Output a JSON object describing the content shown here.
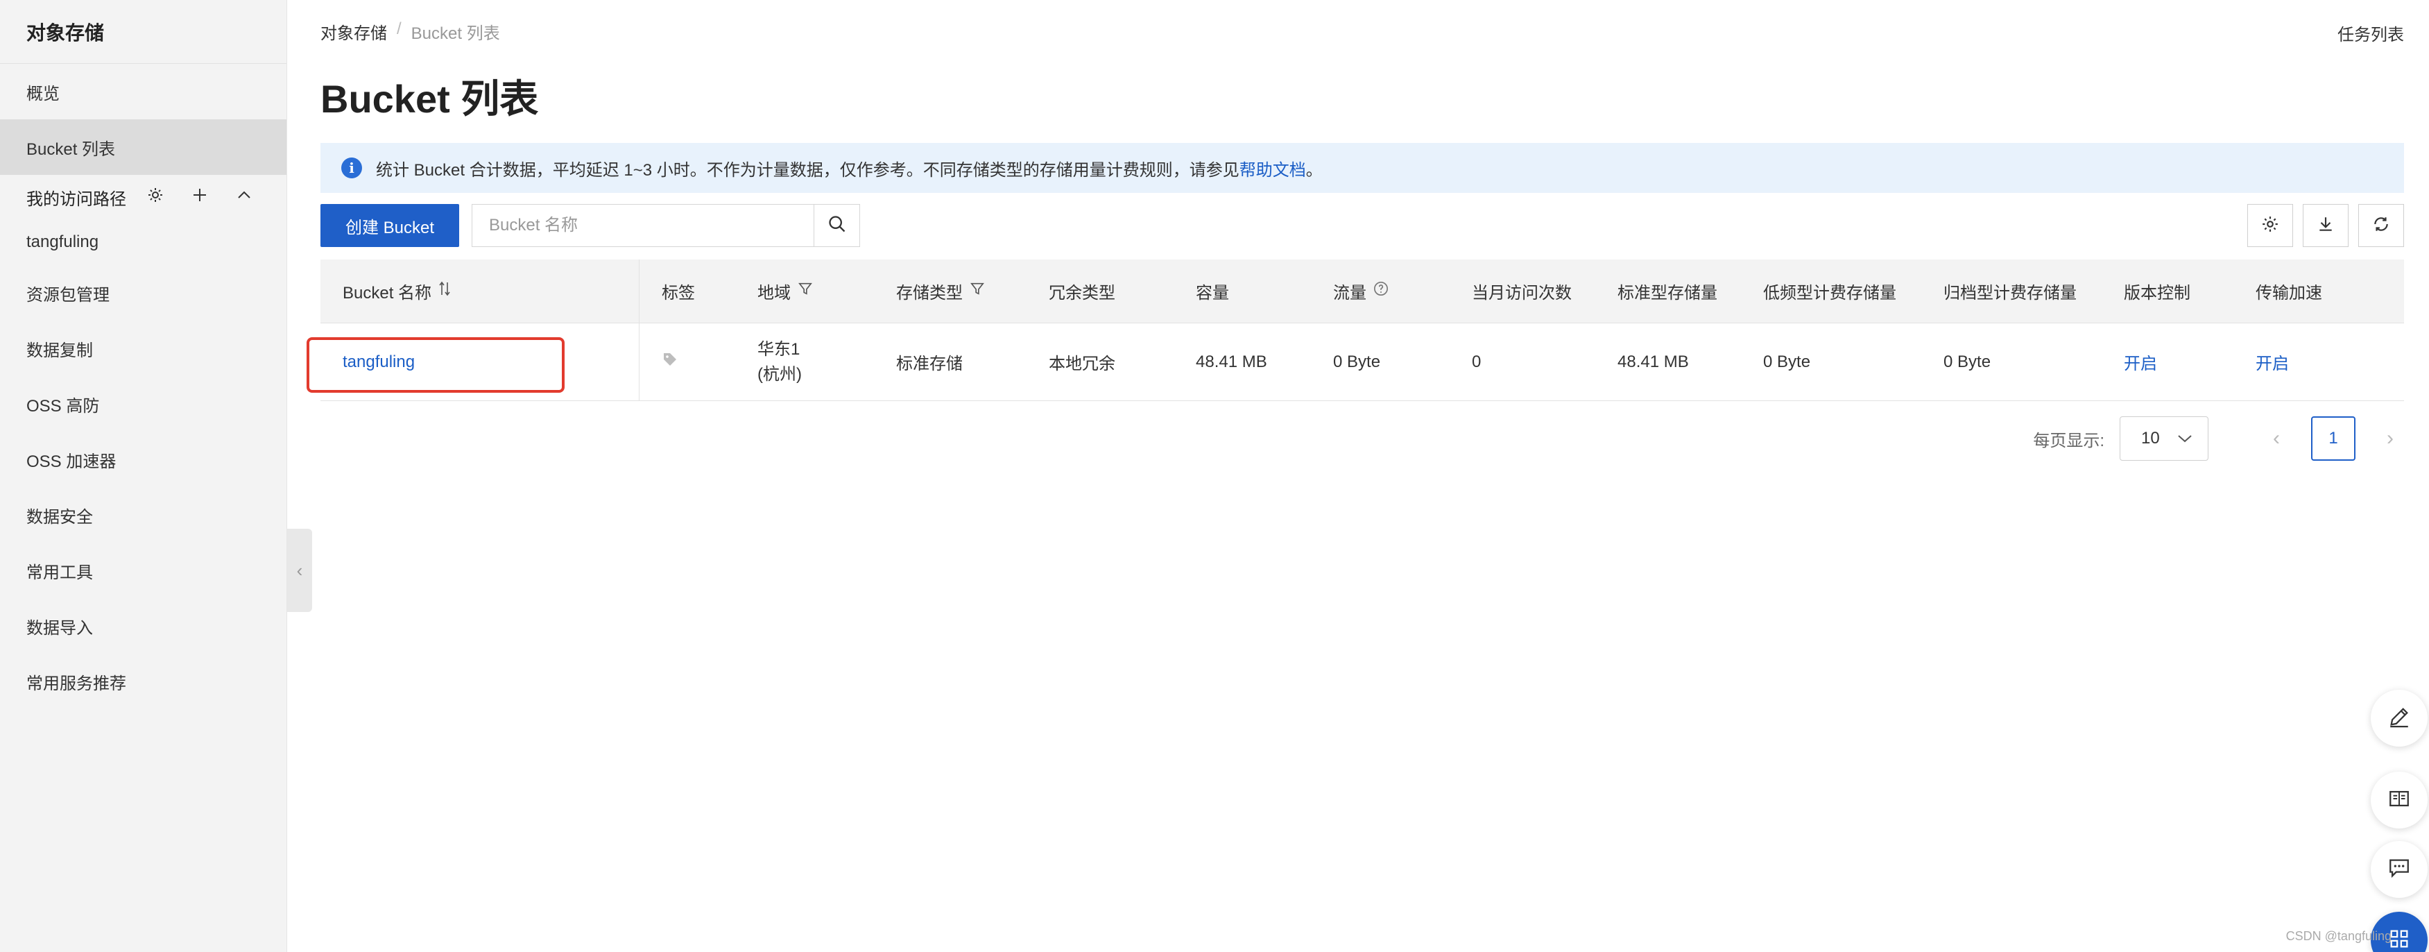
{
  "sidebar": {
    "title": "对象存储",
    "items": [
      {
        "label": "概览"
      },
      {
        "label": "Bucket 列表",
        "active": true
      }
    ],
    "group_label": "我的访问路径",
    "group_items": [
      {
        "label": "tangfuling"
      }
    ],
    "more_items": [
      {
        "label": "资源包管理"
      },
      {
        "label": "数据复制"
      },
      {
        "label": "OSS 高防"
      },
      {
        "label": "OSS 加速器"
      },
      {
        "label": "数据安全"
      },
      {
        "label": "常用工具"
      },
      {
        "label": "数据导入"
      },
      {
        "label": "常用服务推荐"
      }
    ]
  },
  "breadcrumb": {
    "root": "对象存储",
    "sep": "/",
    "current": "Bucket 列表"
  },
  "header": {
    "title": "Bucket 列表",
    "task_list": "任务列表"
  },
  "notice": {
    "text": "统计 Bucket 合计数据，平均延迟 1~3 小时。不作为计量数据，仅作参考。不同存储类型的存储用量计费规则，请参见",
    "link": "帮助文档",
    "end": "。"
  },
  "toolbar": {
    "create_label": "创建 Bucket",
    "search_placeholder": "Bucket 名称"
  },
  "table": {
    "columns": [
      "Bucket 名称",
      "标签",
      "地域",
      "存储类型",
      "冗余类型",
      "容量",
      "流量",
      "当月访问次数",
      "标准型存储量",
      "低频型计费存储量",
      "归档型计费存储量",
      "版本控制",
      "传输加速"
    ],
    "rows": [
      {
        "name": "tangfuling",
        "region_line1": "华东1",
        "region_line2": "(杭州)",
        "storage_type": "标准存储",
        "redundancy": "本地冗余",
        "capacity": "48.41 MB",
        "traffic": "0 Byte",
        "visits": "0",
        "standard_storage": "48.41 MB",
        "ia_storage": "0 Byte",
        "archive_storage": "0 Byte",
        "versioning": "开启",
        "acceleration": "开启"
      }
    ]
  },
  "pagination": {
    "per_page_label": "每页显示:",
    "per_page": "10",
    "current_page": "1"
  },
  "watermark": "CSDN @tangfuling",
  "colors": {
    "primary": "#1f5fc8",
    "link": "#1b5ec6",
    "highlight": "#e23b2e",
    "notice_bg": "#e8f2fc"
  }
}
